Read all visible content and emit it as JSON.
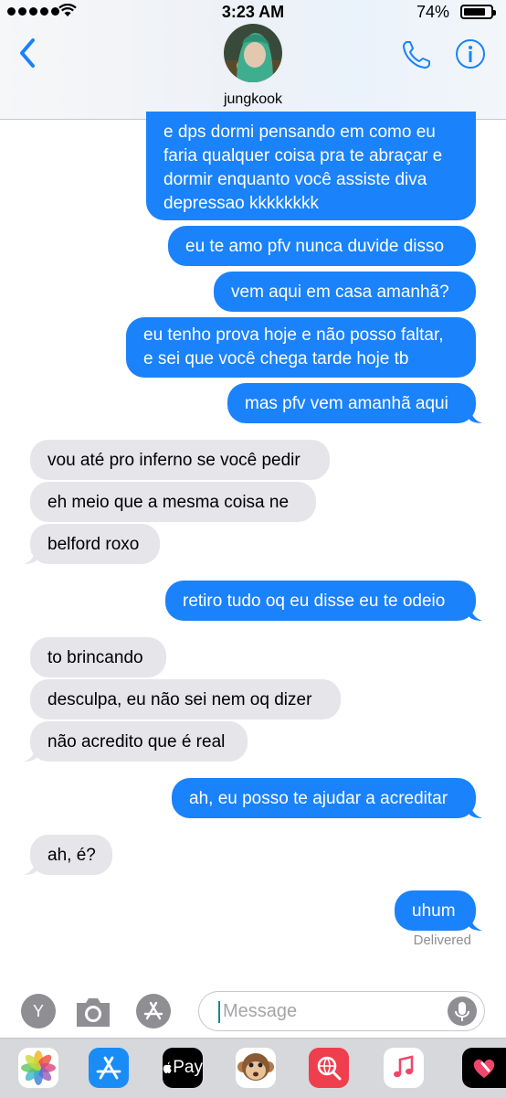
{
  "status_bar": {
    "time": "3:23 AM",
    "battery": "74%"
  },
  "header": {
    "contact_name": "jungkook"
  },
  "messages": [
    {
      "lines": [
        "e dps dormi pensando em como eu",
        "faria qualquer coisa pra te abraçar e",
        "dormir enquanto você assiste diva",
        "depressao kkkkkkkk"
      ]
    },
    {
      "text": "eu te amo pfv nunca duvide disso"
    },
    {
      "text": "vem aqui em casa amanhã?"
    },
    {
      "lines": [
        "eu tenho prova hoje e não posso faltar,",
        "e sei que você chega tarde hoje tb"
      ]
    },
    {
      "text": "mas pfv vem amanhã aqui"
    },
    {
      "text": "vou até pro inferno se você pedir"
    },
    {
      "text": "eh meio que a mesma coisa ne"
    },
    {
      "text": "belford roxo"
    },
    {
      "text": "retiro tudo oq eu disse eu te odeio"
    },
    {
      "text": "to brincando"
    },
    {
      "text": "desculpa, eu não sei nem oq dizer"
    },
    {
      "text": "não acredito que é real"
    },
    {
      "text": "ah, eu posso te ajudar a acreditar"
    },
    {
      "text": "ah, é?"
    },
    {
      "text": "uhum"
    }
  ],
  "delivery_status": "Delivered",
  "input": {
    "placeholder": "Message",
    "effects_label": "Y"
  },
  "app_tray": [
    {
      "name": "photos",
      "icon": "photos-icon"
    },
    {
      "name": "app-store",
      "icon": "app-store-icon"
    },
    {
      "name": "apple-pay",
      "icon": "apple-pay-icon",
      "label": "Pay"
    },
    {
      "name": "animoji",
      "icon": "monkey-icon"
    },
    {
      "name": "images-search",
      "icon": "globe-search-icon"
    },
    {
      "name": "music",
      "icon": "music-note-icon"
    },
    {
      "name": "digital-touch",
      "icon": "heart-touch-icon"
    }
  ],
  "colors": {
    "sent_bubble": "#1a82fb",
    "received_bubble": "#e5e5ea",
    "accent": "#1a82fb"
  }
}
